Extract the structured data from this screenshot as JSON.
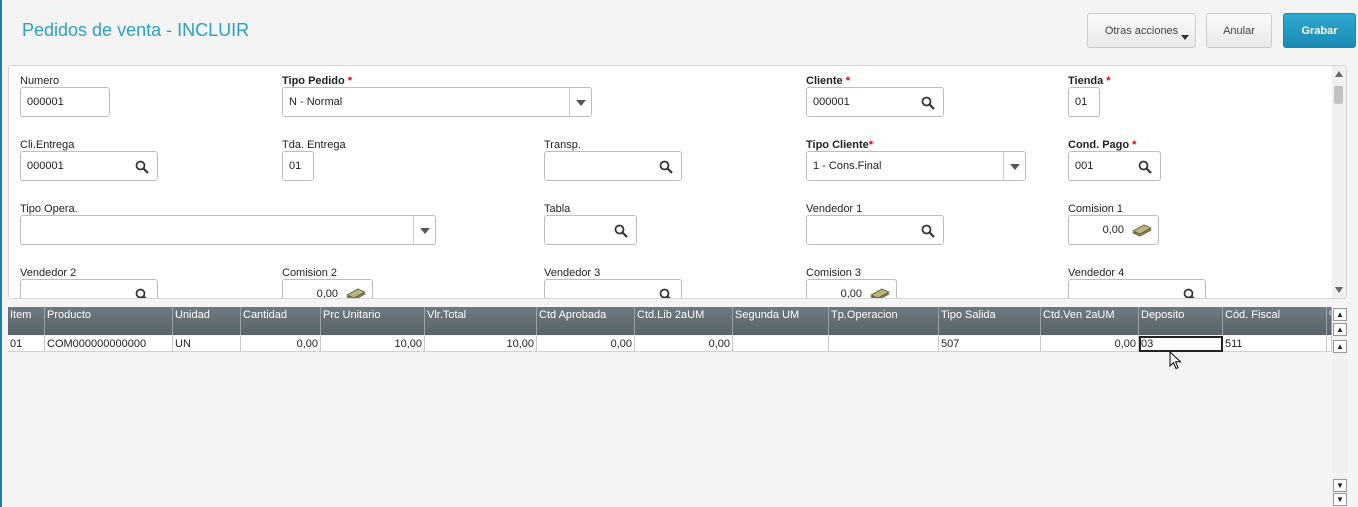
{
  "header": {
    "title": "Pedidos de venta - INCLUIR",
    "otras_acciones": "Otras acciones",
    "anular": "Anular",
    "grabar": "Grabar"
  },
  "form": {
    "numero": {
      "label": "Numero",
      "value": "000001"
    },
    "tipo_pedido": {
      "label": "Tipo Pedido",
      "value": "N - Normal",
      "required": "*"
    },
    "cliente": {
      "label": "Cliente",
      "value": "000001",
      "required": "*"
    },
    "tienda": {
      "label": "Tienda",
      "value": "01",
      "required": "*"
    },
    "cli_entrega": {
      "label": "Cli.Entrega",
      "value": "000001"
    },
    "tda_entrega": {
      "label": "Tda. Entrega",
      "value": "01"
    },
    "transp": {
      "label": "Transp.",
      "value": ""
    },
    "tipo_cliente": {
      "label": "Tipo Cliente",
      "value": "1 - Cons.Final",
      "required": "*"
    },
    "cond_pago": {
      "label": "Cond. Pago",
      "value": "001",
      "required": "*"
    },
    "tipo_opera": {
      "label": "Tipo Opera.",
      "value": ""
    },
    "tabla": {
      "label": "Tabla",
      "value": ""
    },
    "vendedor1": {
      "label": "Vendedor 1",
      "value": ""
    },
    "comision1": {
      "label": "Comision 1",
      "value": "0,00"
    },
    "vendedor2": {
      "label": "Vendedor 2",
      "value": ""
    },
    "comision2": {
      "label": "Comision 2",
      "value": "0,00"
    },
    "vendedor3": {
      "label": "Vendedor 3",
      "value": ""
    },
    "comision3": {
      "label": "Comision 3",
      "value": "0,00"
    },
    "vendedor4": {
      "label": "Vendedor 4",
      "value": ""
    }
  },
  "grid": {
    "columns": [
      "Item",
      "Producto",
      "Unidad",
      "Cantidad",
      "Prc Unitario",
      "Vlr.Total",
      "Ctd Aprobada",
      "Ctd.Lib 2aUM",
      "Segunda UM",
      "Tp.Operacion",
      "Tipo Salida",
      "Ctd.Ven 2aUM",
      "Deposito",
      "Cód. Fiscal",
      "%"
    ],
    "row": [
      "01",
      "COM000000000000",
      "UN",
      "0,00",
      "10,00",
      "10,00",
      "0,00",
      "0,00",
      "",
      "",
      "507",
      "0,00",
      "03",
      "511",
      ""
    ]
  },
  "colors": {
    "accent": "#2ba0c4",
    "grid_header": "#5f6a70",
    "required": "#dd0000"
  }
}
